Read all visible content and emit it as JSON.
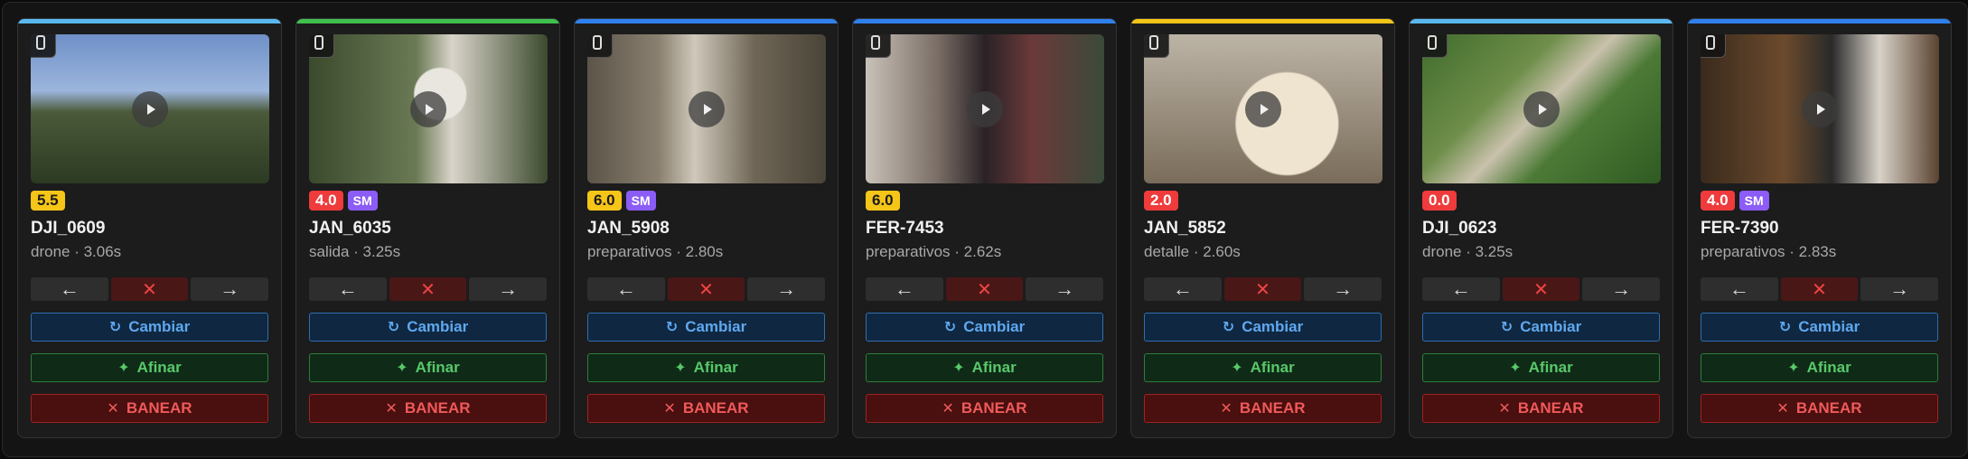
{
  "labels": {
    "cambiar": "Cambiar",
    "afinar": "Afinar",
    "banear": "BANEAR",
    "prev_arrow": "←",
    "delete_x": "✕",
    "next_arrow": "→",
    "refresh_glyph": "↻",
    "sparkle_glyph": "✦",
    "ban_glyph": "✕"
  },
  "colors": {
    "accent_blue": "#2f80ed",
    "accent_green": "#3fbf4f",
    "accent_yellow": "#f5c518",
    "accent_cyan": "#5ab8f0",
    "badge_sm": "#8b5cf6"
  },
  "clips": [
    {
      "name": "DJI_0609",
      "meta": "drone · 3.06s",
      "score": "5.5",
      "score_color": "yellow",
      "sm": "",
      "accent": "#5ab8f0"
    },
    {
      "name": "JAN_6035",
      "meta": "salida · 3.25s",
      "score": "4.0",
      "score_color": "red",
      "sm": "SM",
      "accent": "#3fbf4f"
    },
    {
      "name": "JAN_5908",
      "meta": "preparativos · 2.80s",
      "score": "6.0",
      "score_color": "yellow",
      "sm": "SM",
      "accent": "#2f80ed"
    },
    {
      "name": "FER-7453",
      "meta": "preparativos · 2.62s",
      "score": "6.0",
      "score_color": "yellow",
      "sm": "",
      "accent": "#2f80ed"
    },
    {
      "name": "JAN_5852",
      "meta": "detalle · 2.60s",
      "score": "2.0",
      "score_color": "red",
      "sm": "",
      "accent": "#f5c518"
    },
    {
      "name": "DJI_0623",
      "meta": "drone · 3.25s",
      "score": "0.0",
      "score_color": "red",
      "sm": "",
      "accent": "#5ab8f0"
    },
    {
      "name": "FER-7390",
      "meta": "preparativos · 2.83s",
      "score": "4.0",
      "score_color": "red",
      "sm": "SM",
      "accent": "#2f80ed"
    }
  ]
}
